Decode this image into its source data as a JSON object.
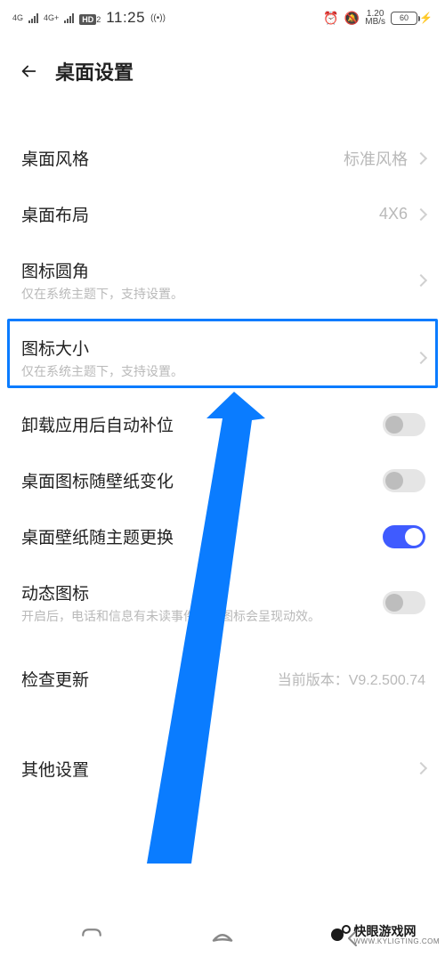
{
  "status": {
    "net1": "4G",
    "net2": "4G+",
    "hd": "HD",
    "hd2": "2",
    "time": "11:25",
    "speed_top": "1.20",
    "speed_bot": "MB/s",
    "battery": "60"
  },
  "header": {
    "title": "桌面设置"
  },
  "rows": {
    "style": {
      "label": "桌面风格",
      "value": "标准风格"
    },
    "layout": {
      "label": "桌面布局",
      "value": "4X6"
    },
    "corner": {
      "label": "图标圆角",
      "sub": "仅在系统主题下，支持设置。"
    },
    "size": {
      "label": "图标大小",
      "sub": "仅在系统主题下，支持设置。"
    },
    "autofill": {
      "label": "卸载应用后自动补位"
    },
    "iconwp": {
      "label": "桌面图标随壁纸变化"
    },
    "wptheme": {
      "label": "桌面壁纸随主题更换"
    },
    "dynicon": {
      "label": "动态图标",
      "sub": "开启后，电话和信息有未读事件时，图标会呈现动效。"
    },
    "update": {
      "label": "检查更新",
      "value": "当前版本：V9.2.500.74"
    },
    "other": {
      "label": "其他设置"
    }
  },
  "watermark": {
    "name": "快眼游戏网",
    "url": "WWW.KYLIGTING.COM"
  }
}
